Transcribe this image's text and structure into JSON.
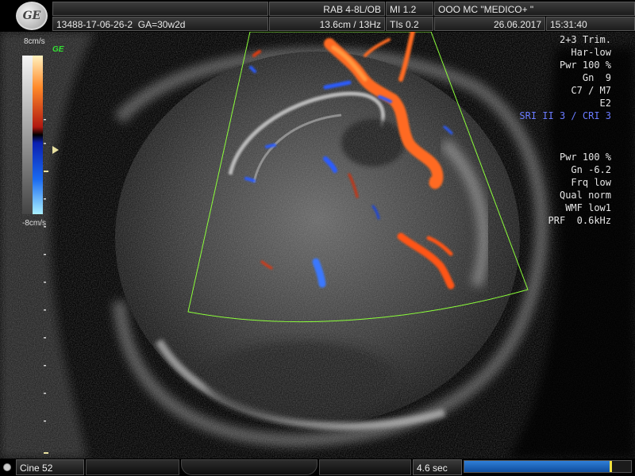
{
  "header": {
    "logo_text": "GE",
    "patient_id": "13488-17-06-26-2",
    "ga": "GA=30w2d",
    "probe": "RAB 4-8L/OB",
    "depth_freq": "13.6cm / 13Hz",
    "mi": "MI  1.2",
    "tis": "TIs  0.2",
    "clinic": "OOO  MC \"MEDICO+ \"",
    "date": "26.06.2017",
    "time": "15:31:40"
  },
  "scale": {
    "top_label": "8cm/s",
    "bottom_label": "-8cm/s",
    "badge": "GE"
  },
  "side_params": {
    "bmode": [
      "2+3 Trim.",
      "Har-low",
      "Pwr 100 %",
      "Gn  9",
      "C7 / M7",
      "E2"
    ],
    "sri": "SRI II 3 / CRI 3",
    "color": [
      "Pwr 100 %",
      "Gn -6.2",
      "Frq low",
      "Qual norm",
      "WMF low1",
      "PRF  0.6kHz"
    ]
  },
  "footer": {
    "cine_label": "Cine 52",
    "time_label": "4.6 sec",
    "progress": 0.88
  },
  "colors": {
    "doppler_red": "#ff6a20",
    "doppler_blue": "#2a5cff",
    "roi_outline": "#8cff3a"
  }
}
